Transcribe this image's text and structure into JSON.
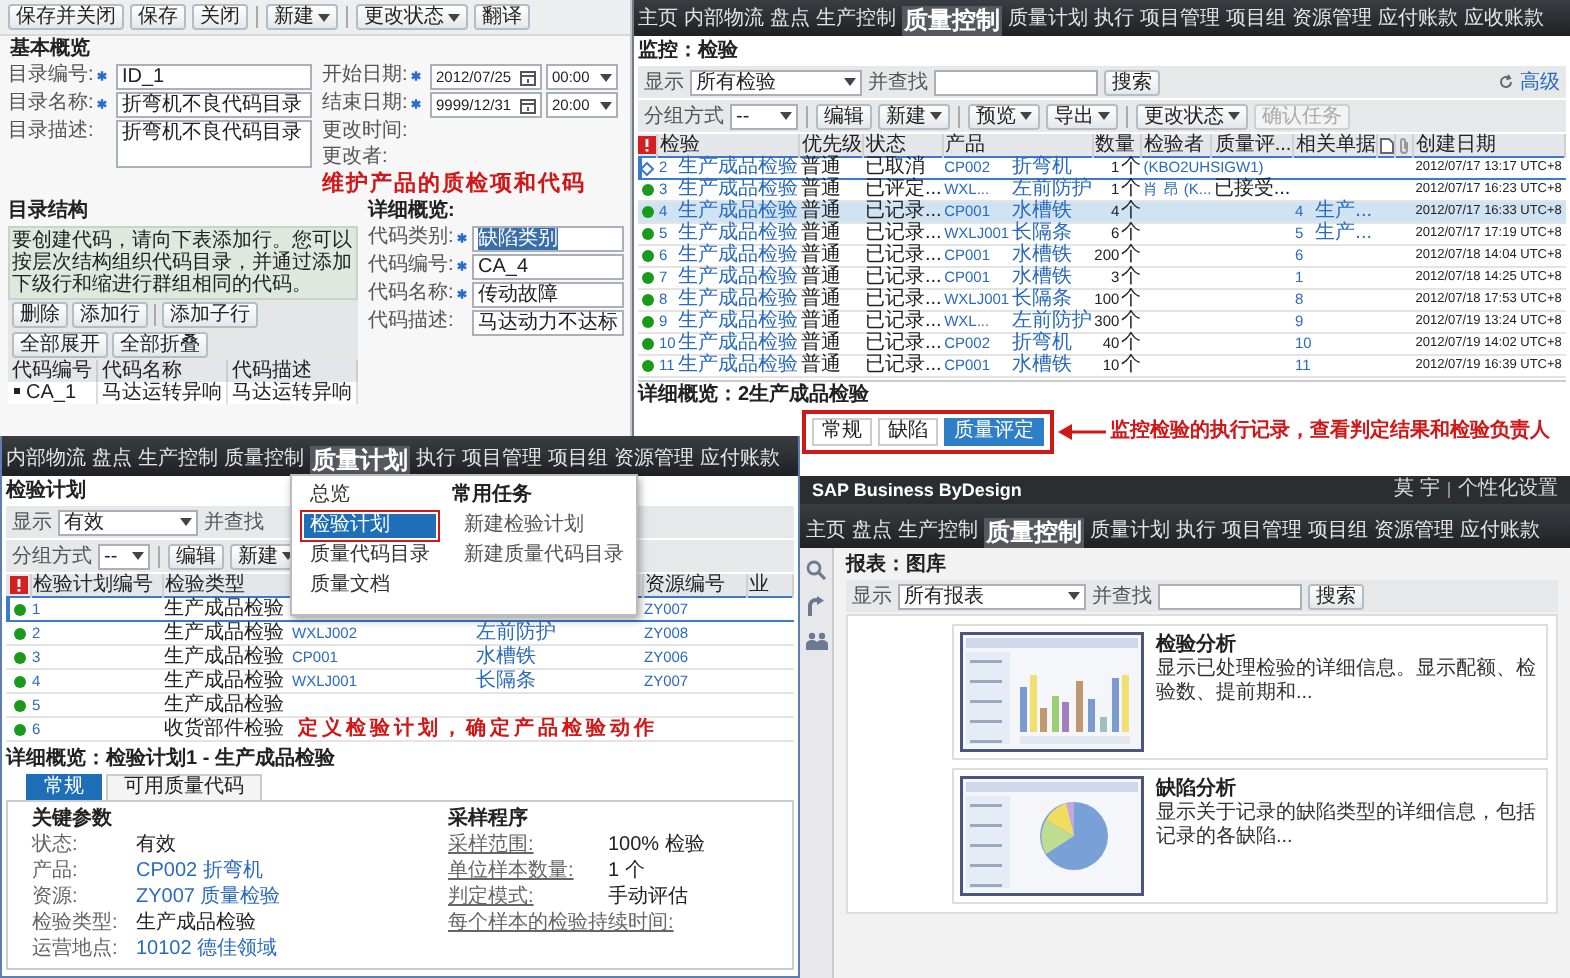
{
  "catalog_window": {
    "toolbar": [
      {
        "label": "保存并关闭",
        "dropdown": false,
        "separator_before": false
      },
      {
        "label": "保存",
        "dropdown": false,
        "separator_before": false
      },
      {
        "label": "关闭",
        "dropdown": false,
        "separator_before": false
      },
      {
        "label": "新建",
        "dropdown": true,
        "separator_before": true
      },
      {
        "label": "更改状态",
        "dropdown": true,
        "separator_before": true
      },
      {
        "label": "翻译",
        "dropdown": false,
        "separator_before": false
      }
    ],
    "title": "基本概览",
    "fields_left": [
      {
        "label": "目录编号:",
        "required": true,
        "kind": "text",
        "value": "ID_1"
      },
      {
        "label": "目录名称:",
        "required": true,
        "kind": "text",
        "value": "折弯机不良代码目录"
      },
      {
        "label": "目录描述:",
        "required": false,
        "kind": "textarea",
        "value": "折弯机不良代码目录"
      }
    ],
    "fields_right": [
      {
        "label": "开始日期:",
        "required": true,
        "kind": "datetime",
        "date": "2012/07/25",
        "time": "00:00"
      },
      {
        "label": "结束日期:",
        "required": true,
        "kind": "datetime",
        "date": "9999/12/31",
        "time": "20:00"
      },
      {
        "label": "更改时间:",
        "required": false,
        "kind": "readonly"
      },
      {
        "label": "更改者:",
        "required": false,
        "kind": "readonly"
      }
    ],
    "annotation": "维护产品的质检项和代码",
    "structure": {
      "title": "目录结构",
      "help": "要创建代码，请向下表添加行。您可以按层次结构组织代码目录，并通过添加下级行和缩进行群组相同的代码。",
      "buttons": [
        {
          "label": "删除",
          "separator_before": false
        },
        {
          "label": "添加行",
          "separator_before": false
        },
        {
          "label": "添加子行",
          "separator_before": true
        },
        {
          "label": "全部展开",
          "separator_before": false
        },
        {
          "label": "全部折叠",
          "separator_before": false
        }
      ],
      "columns": [
        "代码编号",
        "代码名称",
        "代码描述"
      ],
      "rows": [
        {
          "cells": [
            "CA_1",
            "马达运转异响",
            "马达运转异响"
          ]
        }
      ]
    },
    "details": {
      "title": "详细概览:",
      "fields": [
        {
          "label": "代码类别:",
          "required": true,
          "value": "缺陷类别",
          "highlighted": true
        },
        {
          "label": "代码编号:",
          "required": true,
          "value": "CA_4",
          "highlighted": false
        },
        {
          "label": "代码名称:",
          "required": true,
          "value": "传动故障",
          "highlighted": false
        },
        {
          "label": "代码描述:",
          "required": false,
          "value": "马达动力不达标",
          "highlighted": false
        }
      ]
    }
  },
  "monitor_window": {
    "nav": [
      {
        "label": "主页",
        "selected": false
      },
      {
        "label": "内部物流",
        "selected": false
      },
      {
        "label": "盘点",
        "selected": false
      },
      {
        "label": "生产控制",
        "selected": false
      },
      {
        "label": "质量控制",
        "selected": true
      },
      {
        "label": "质量计划",
        "selected": false
      },
      {
        "label": "执行",
        "selected": false
      },
      {
        "label": "项目管理",
        "selected": false
      },
      {
        "label": "项目组",
        "selected": false
      },
      {
        "label": "资源管理",
        "selected": false
      },
      {
        "label": "应付账款",
        "selected": false
      },
      {
        "label": "应收账款",
        "selected": false
      }
    ],
    "title": "监控：检验",
    "search": {
      "show_label": "显示",
      "show_value": "所有检验",
      "find_label": "并查找",
      "button": "搜索",
      "advanced": "高级"
    },
    "toolbar": {
      "group_label": "分组方式",
      "group_value": "--",
      "buttons": [
        {
          "label": "编辑",
          "dropdown": false,
          "disabled": false,
          "separator_before": true
        },
        {
          "label": "新建",
          "dropdown": true,
          "disabled": false,
          "separator_before": false
        },
        {
          "label": "预览",
          "dropdown": true,
          "disabled": false,
          "separator_before": true
        },
        {
          "label": "导出",
          "dropdown": true,
          "disabled": false,
          "separator_before": false
        },
        {
          "label": "更改状态",
          "dropdown": true,
          "disabled": false,
          "separator_before": true
        },
        {
          "label": "确认任务",
          "dropdown": false,
          "disabled": true,
          "separator_before": false
        }
      ]
    },
    "columns": {
      "inspection": "检验",
      "priority": "优先级",
      "status": "状态",
      "product": "产品",
      "quantity": "数量",
      "inspector": "检验者",
      "quality": "质量评...",
      "related": "相关单据",
      "created": "创建日期"
    },
    "rows": [
      {
        "kind": "diamond",
        "selected": false,
        "focused": true,
        "id": "2",
        "type": "生产成品检验",
        "priority": "普通",
        "status": "已取消",
        "product_code": "CP002",
        "product_name": "折弯机",
        "qty": "1",
        "unit": "个",
        "inspector": "(KBO2UHSIGW1)",
        "created": "2012/07/17 13:17 UTC+8"
      },
      {
        "kind": "dot",
        "selected": false,
        "focused": false,
        "id": "3",
        "type": "生产成品检验",
        "priority": "普通",
        "status": "已评定...",
        "product_code": "WXL...",
        "product_name": "左前防护",
        "qty": "1",
        "unit": "个",
        "inspector": "肖 昂 (K...",
        "quality": "已接受...",
        "created": "2012/07/17 16:23 UTC+8"
      },
      {
        "kind": "dot",
        "selected": true,
        "focused": false,
        "id": "4",
        "type": "生产成品检验",
        "priority": "普通",
        "status": "已记录...",
        "product_code": "CP001",
        "product_name": "水槽铁",
        "qty": "4",
        "unit": "个",
        "related_id": "4",
        "related_type": "生产...",
        "created": "2012/07/17 16:33 UTC+8"
      },
      {
        "kind": "dot",
        "selected": false,
        "focused": false,
        "id": "5",
        "type": "生产成品检验",
        "priority": "普通",
        "status": "已记录...",
        "product_code": "WXLJ001",
        "product_name": "长隔条",
        "qty": "6",
        "unit": "个",
        "related_id": "5",
        "related_type": "生产...",
        "created": "2012/07/17 17:19 UTC+8"
      },
      {
        "kind": "dot",
        "selected": false,
        "focused": false,
        "id": "6",
        "type": "生产成品检验",
        "priority": "普通",
        "status": "已记录...",
        "product_code": "CP001",
        "product_name": "水槽铁",
        "qty": "200",
        "unit": "个",
        "related_id": "6",
        "created": "2012/07/18 14:04 UTC+8"
      },
      {
        "kind": "dot",
        "selected": false,
        "focused": false,
        "id": "7",
        "type": "生产成品检验",
        "priority": "普通",
        "status": "已记录...",
        "product_code": "CP001",
        "product_name": "水槽铁",
        "qty": "3",
        "unit": "个",
        "related_id": "1",
        "created": "2012/07/18 14:25 UTC+8"
      },
      {
        "kind": "dot",
        "selected": false,
        "focused": false,
        "id": "8",
        "type": "生产成品检验",
        "priority": "普通",
        "status": "已记录...",
        "product_code": "WXLJ001",
        "product_name": "长隔条",
        "qty": "100",
        "unit": "个",
        "related_id": "8",
        "created": "2012/07/18 17:53 UTC+8"
      },
      {
        "kind": "dot",
        "selected": false,
        "focused": false,
        "id": "9",
        "type": "生产成品检验",
        "priority": "普通",
        "status": "已记录...",
        "product_code": "WXL...",
        "product_name": "左前防护",
        "qty": "300",
        "unit": "个",
        "related_id": "9",
        "created": "2012/07/19 13:24 UTC+8"
      },
      {
        "kind": "dot",
        "selected": false,
        "focused": false,
        "id": "10",
        "type": "生产成品检验",
        "priority": "普通",
        "status": "已记录...",
        "product_code": "CP002",
        "product_name": "折弯机",
        "qty": "40",
        "unit": "个",
        "related_id": "10",
        "created": "2012/07/19 14:02 UTC+8"
      },
      {
        "kind": "dot",
        "selected": false,
        "focused": false,
        "id": "11",
        "type": "生产成品检验",
        "priority": "普通",
        "status": "已记录...",
        "product_code": "CP001",
        "product_name": "水槽铁",
        "qty": "10",
        "unit": "个",
        "related_id": "11",
        "created": "2012/07/19 16:39 UTC+8"
      }
    ],
    "details": {
      "title": "详细概览：2生产成品检验",
      "tabs": [
        {
          "label": "常规",
          "selected": false
        },
        {
          "label": "缺陷",
          "selected": false
        },
        {
          "label": "质量评定",
          "selected": true
        }
      ],
      "annotation": "监控检验的执行记录，查看判定结果和检验负责人"
    }
  },
  "plan_window": {
    "nav": [
      {
        "label": "内部物流",
        "selected": false
      },
      {
        "label": "盘点",
        "selected": false
      },
      {
        "label": "生产控制",
        "selected": false
      },
      {
        "label": "质量控制",
        "selected": false
      },
      {
        "label": "质量计划",
        "selected": true
      },
      {
        "label": "执行",
        "selected": false
      },
      {
        "label": "项目管理",
        "selected": false
      },
      {
        "label": "项目组",
        "selected": false
      },
      {
        "label": "资源管理",
        "selected": false
      },
      {
        "label": "应付账款",
        "selected": false
      }
    ],
    "menu": {
      "items": [
        {
          "label": "总览",
          "selected": false
        },
        {
          "label": "检验计划",
          "selected": true
        },
        {
          "label": "质量代码目录",
          "selected": false
        },
        {
          "label": "质量文档",
          "selected": false
        }
      ],
      "tasks_title": "常用任务",
      "tasks": [
        "新建检验计划",
        "新建质量代码目录"
      ]
    },
    "title": "检验计划",
    "search": {
      "show_label": "显示",
      "show_value": "有效",
      "find_label": "并查找"
    },
    "toolbar": {
      "group_label": "分组方式",
      "group_value": "--",
      "buttons": [
        {
          "label": "编辑",
          "dropdown": false
        },
        {
          "label": "新建",
          "dropdown": true
        }
      ]
    },
    "columns": {
      "plan_id": "检验计划编号",
      "type": "检验类型",
      "resource": "资源编号",
      "column_7": "业"
    },
    "rows": [
      {
        "selected": true,
        "id": "1",
        "type": "生产成品检验",
        "resource": "ZY007"
      },
      {
        "selected": false,
        "id": "2",
        "type": "生产成品检验",
        "product_code": "WXLJ002",
        "product_name": "左前防护",
        "resource": "ZY008"
      },
      {
        "selected": false,
        "id": "3",
        "type": "生产成品检验",
        "product_code": "CP001",
        "product_name": "水槽铁",
        "resource": "ZY006"
      },
      {
        "selected": false,
        "id": "4",
        "type": "生产成品检验",
        "product_code": "WXLJ001",
        "product_name": "长隔条",
        "resource": "ZY007"
      },
      {
        "selected": false,
        "id": "5",
        "type": "生产成品检验"
      },
      {
        "selected": false,
        "id": "6",
        "type": "收货部件检验"
      }
    ],
    "annotation": "定义检验计划，确定产品检验动作",
    "details": {
      "title": "详细概览：检验计划1 - 生产成品检验",
      "tabs": [
        {
          "label": "常规",
          "selected": true
        },
        {
          "label": "可用质量代码",
          "selected": false
        }
      ],
      "key_title": "关键参数",
      "key_fields": [
        {
          "label": "状态:",
          "value": "有效",
          "link": false
        },
        {
          "label": "产品:",
          "value": "CP002 折弯机",
          "link": true
        },
        {
          "label": "资源:",
          "value": "ZY007 质量检验",
          "link": true
        },
        {
          "label": "检验类型:",
          "value": "生产成品检验",
          "link": false
        },
        {
          "label": "运营地点:",
          "value": "10102 德佳领域",
          "link": true
        }
      ],
      "sampling_title": "采样程序",
      "sampling_fields": [
        {
          "label": "采样范围:",
          "value": "100% 检验"
        },
        {
          "label": "单位样本数量:",
          "value": "1 个"
        },
        {
          "label": "判定模式:",
          "value": "手动评估"
        },
        {
          "label": "每个样本的检验持续时间:"
        }
      ]
    }
  },
  "reports_window": {
    "brand": "SAP Business ByDesign",
    "user": "莫 宇",
    "personalize": "个性化设置",
    "nav": [
      {
        "label": "主页",
        "selected": false
      },
      {
        "label": "盘点",
        "selected": false
      },
      {
        "label": "生产控制",
        "selected": false
      },
      {
        "label": "质量控制",
        "selected": true
      },
      {
        "label": "质量计划",
        "selected": false
      },
      {
        "label": "执行",
        "selected": false
      },
      {
        "label": "项目管理",
        "selected": false
      },
      {
        "label": "项目组",
        "selected": false
      },
      {
        "label": "资源管理",
        "selected": false
      },
      {
        "label": "应付账款",
        "selected": false
      }
    ],
    "title": "报表：图库",
    "search": {
      "show_label": "显示",
      "show_value": "所有报表",
      "find_label": "并查找",
      "button": "搜索"
    },
    "reports": [
      {
        "kind": "bar",
        "title": "检验分析",
        "description": "显示已处理检验的详细信息。显示配额、检验数、提前期和..."
      },
      {
        "kind": "pie",
        "title": "缺陷分析",
        "description": "显示关于记录的缺陷类型的详细信息，包括记录的各缺陷..."
      }
    ]
  }
}
